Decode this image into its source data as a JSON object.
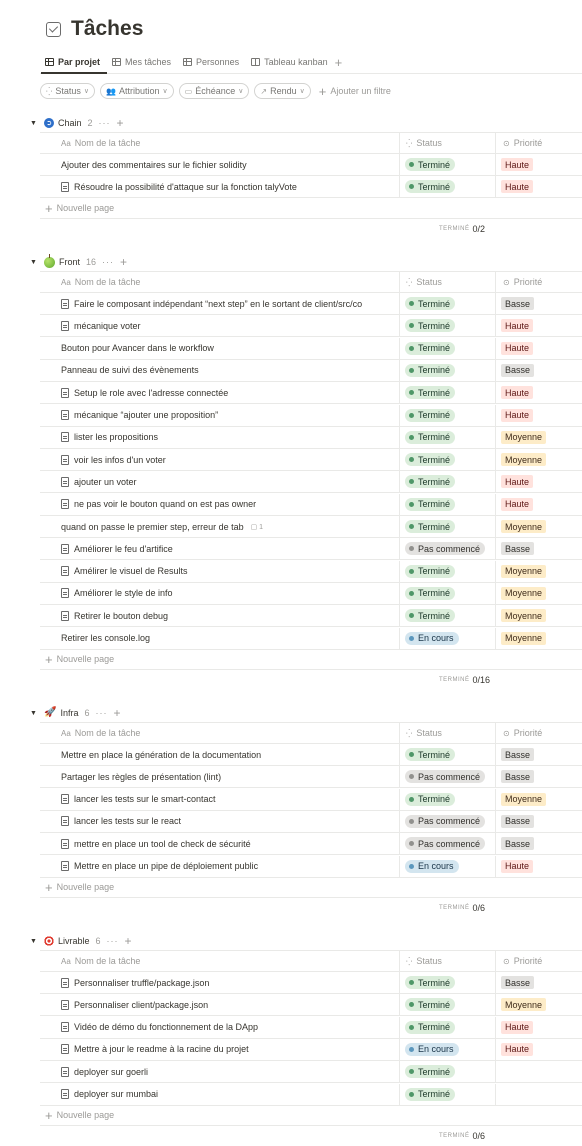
{
  "page": {
    "title": "Tâches"
  },
  "views": [
    {
      "label": "Par projet",
      "icon": "table-icon",
      "active": true
    },
    {
      "label": "Mes tâches",
      "icon": "table-icon",
      "active": false
    },
    {
      "label": "Personnes",
      "icon": "table-icon",
      "active": false
    },
    {
      "label": "Tableau kanban",
      "icon": "board-icon",
      "active": false
    }
  ],
  "filters": {
    "chips": [
      {
        "label": "Status",
        "icon": "status-icon"
      },
      {
        "label": "Attribution",
        "icon": "people-icon"
      },
      {
        "label": "Échéance",
        "icon": "calendar-icon"
      },
      {
        "label": "Rendu",
        "icon": "arrow-icon"
      }
    ],
    "add_label": "Ajouter un filtre"
  },
  "columns": {
    "name": "Nom de la tâche",
    "name_prefix": "Aa",
    "status": "Status",
    "priority": "Priorité"
  },
  "new_page_label": "Nouvelle page",
  "calc_label": "TERMINÉ",
  "colors": {
    "done": "#dbeddb",
    "todo": "#e3e2e0",
    "in_progress": "#d3e5ef",
    "high": "#ffe2dd",
    "medium": "#fdecc8",
    "low": "#e3e2e0"
  },
  "groups": [
    {
      "name": "Chain",
      "emoji": "chain",
      "count": "2",
      "calc": "0/2",
      "rows": [
        {
          "name": "Ajouter des commentaires sur le fichier solidity",
          "doc": false,
          "status": "Terminé",
          "status_kind": "done",
          "priority": "Haute",
          "prio_kind": "high"
        },
        {
          "name": "Résoudre la possibilité d'attaque sur la fonction talyVote",
          "doc": true,
          "status": "Terminé",
          "status_kind": "done",
          "priority": "Haute",
          "prio_kind": "high"
        }
      ]
    },
    {
      "name": "Front",
      "emoji": "apple",
      "count": "16",
      "calc": "0/16",
      "rows": [
        {
          "name": "Faire le composant indépendant “next step” en le sortant de client/src/co",
          "doc": true,
          "status": "Terminé",
          "status_kind": "done",
          "priority": "Basse",
          "prio_kind": "low"
        },
        {
          "name": "mécanique voter",
          "doc": true,
          "status": "Terminé",
          "status_kind": "done",
          "priority": "Haute",
          "prio_kind": "high"
        },
        {
          "name": "Bouton pour Avancer dans le workflow",
          "doc": false,
          "status": "Terminé",
          "status_kind": "done",
          "priority": "Haute",
          "prio_kind": "high"
        },
        {
          "name": "Panneau de suivi des évènements",
          "doc": false,
          "status": "Terminé",
          "status_kind": "done",
          "priority": "Basse",
          "prio_kind": "low"
        },
        {
          "name": "Setup le role avec l'adresse connectée",
          "doc": true,
          "status": "Terminé",
          "status_kind": "done",
          "priority": "Haute",
          "prio_kind": "high"
        },
        {
          "name": "mécanique “ajouter une proposition”",
          "doc": true,
          "status": "Terminé",
          "status_kind": "done",
          "priority": "Haute",
          "prio_kind": "high"
        },
        {
          "name": "lister les propositions",
          "doc": true,
          "status": "Terminé",
          "status_kind": "done",
          "priority": "Moyenne",
          "prio_kind": "medium"
        },
        {
          "name": "voir les infos d'un voter",
          "doc": true,
          "status": "Terminé",
          "status_kind": "done",
          "priority": "Moyenne",
          "prio_kind": "medium"
        },
        {
          "name": "ajouter un voter",
          "doc": true,
          "status": "Terminé",
          "status_kind": "done",
          "priority": "Haute",
          "prio_kind": "high"
        },
        {
          "name": "ne pas voir le bouton quand on est pas owner",
          "doc": true,
          "status": "Terminé",
          "status_kind": "done",
          "priority": "Haute",
          "prio_kind": "high"
        },
        {
          "name": "quand on passe le premier step, erreur de tab",
          "doc": false,
          "comments": "1",
          "status": "Terminé",
          "status_kind": "done",
          "priority": "Moyenne",
          "prio_kind": "medium"
        },
        {
          "name": "Améliorer le feu d'artifice",
          "doc": true,
          "status": "Pas commencé",
          "status_kind": "todo",
          "priority": "Basse",
          "prio_kind": "low"
        },
        {
          "name": "Amélirer le visuel de Results",
          "doc": true,
          "status": "Terminé",
          "status_kind": "done",
          "priority": "Moyenne",
          "prio_kind": "medium"
        },
        {
          "name": "Améliorer le style de info",
          "doc": true,
          "status": "Terminé",
          "status_kind": "done",
          "priority": "Moyenne",
          "prio_kind": "medium"
        },
        {
          "name": "Retirer le bouton debug",
          "doc": true,
          "status": "Terminé",
          "status_kind": "done",
          "priority": "Moyenne",
          "prio_kind": "medium"
        },
        {
          "name": "Retirer les console.log",
          "doc": false,
          "status": "En cours",
          "status_kind": "prog",
          "priority": "Moyenne",
          "prio_kind": "medium"
        }
      ]
    },
    {
      "name": "Infra",
      "emoji": "rocket",
      "count": "6",
      "calc": "0/6",
      "rows": [
        {
          "name": "Mettre en place la génération de la documentation",
          "doc": false,
          "status": "Terminé",
          "status_kind": "done",
          "priority": "Basse",
          "prio_kind": "low"
        },
        {
          "name": "Partager les règles de présentation (lint)",
          "doc": false,
          "status": "Pas commencé",
          "status_kind": "todo",
          "priority": "Basse",
          "prio_kind": "low"
        },
        {
          "name": "lancer les tests sur le smart-contact",
          "doc": true,
          "status": "Terminé",
          "status_kind": "done",
          "priority": "Moyenne",
          "prio_kind": "medium"
        },
        {
          "name": "lancer les tests sur le react",
          "doc": true,
          "status": "Pas commencé",
          "status_kind": "todo",
          "priority": "Basse",
          "prio_kind": "low"
        },
        {
          "name": "mettre en place un tool de check de sécurité",
          "doc": true,
          "status": "Pas commencé",
          "status_kind": "todo",
          "priority": "Basse",
          "prio_kind": "low"
        },
        {
          "name": "Mettre en place un pipe de déploiement public",
          "doc": true,
          "status": "En cours",
          "status_kind": "prog",
          "priority": "Haute",
          "prio_kind": "high"
        }
      ]
    },
    {
      "name": "Livrable",
      "emoji": "target",
      "count": "6",
      "calc": "0/6",
      "rows": [
        {
          "name": "Personnaliser truffle/package.json",
          "doc": true,
          "status": "Terminé",
          "status_kind": "done",
          "priority": "Basse",
          "prio_kind": "low"
        },
        {
          "name": "Personnaliser client/package.json",
          "doc": true,
          "status": "Terminé",
          "status_kind": "done",
          "priority": "Moyenne",
          "prio_kind": "medium"
        },
        {
          "name": "Vidéo de démo du fonctionnement de la DApp",
          "doc": true,
          "status": "Terminé",
          "status_kind": "done",
          "priority": "Haute",
          "prio_kind": "high"
        },
        {
          "name": "Mettre à jour le readme à la racine du projet",
          "doc": true,
          "status": "En cours",
          "status_kind": "prog",
          "priority": "Haute",
          "prio_kind": "high"
        },
        {
          "name": "deployer sur goerli",
          "doc": true,
          "status": "Terminé",
          "status_kind": "done",
          "priority": "",
          "prio_kind": ""
        },
        {
          "name": "deployer sur mumbai",
          "doc": true,
          "status": "Terminé",
          "status_kind": "done",
          "priority": "",
          "prio_kind": ""
        }
      ]
    }
  ]
}
